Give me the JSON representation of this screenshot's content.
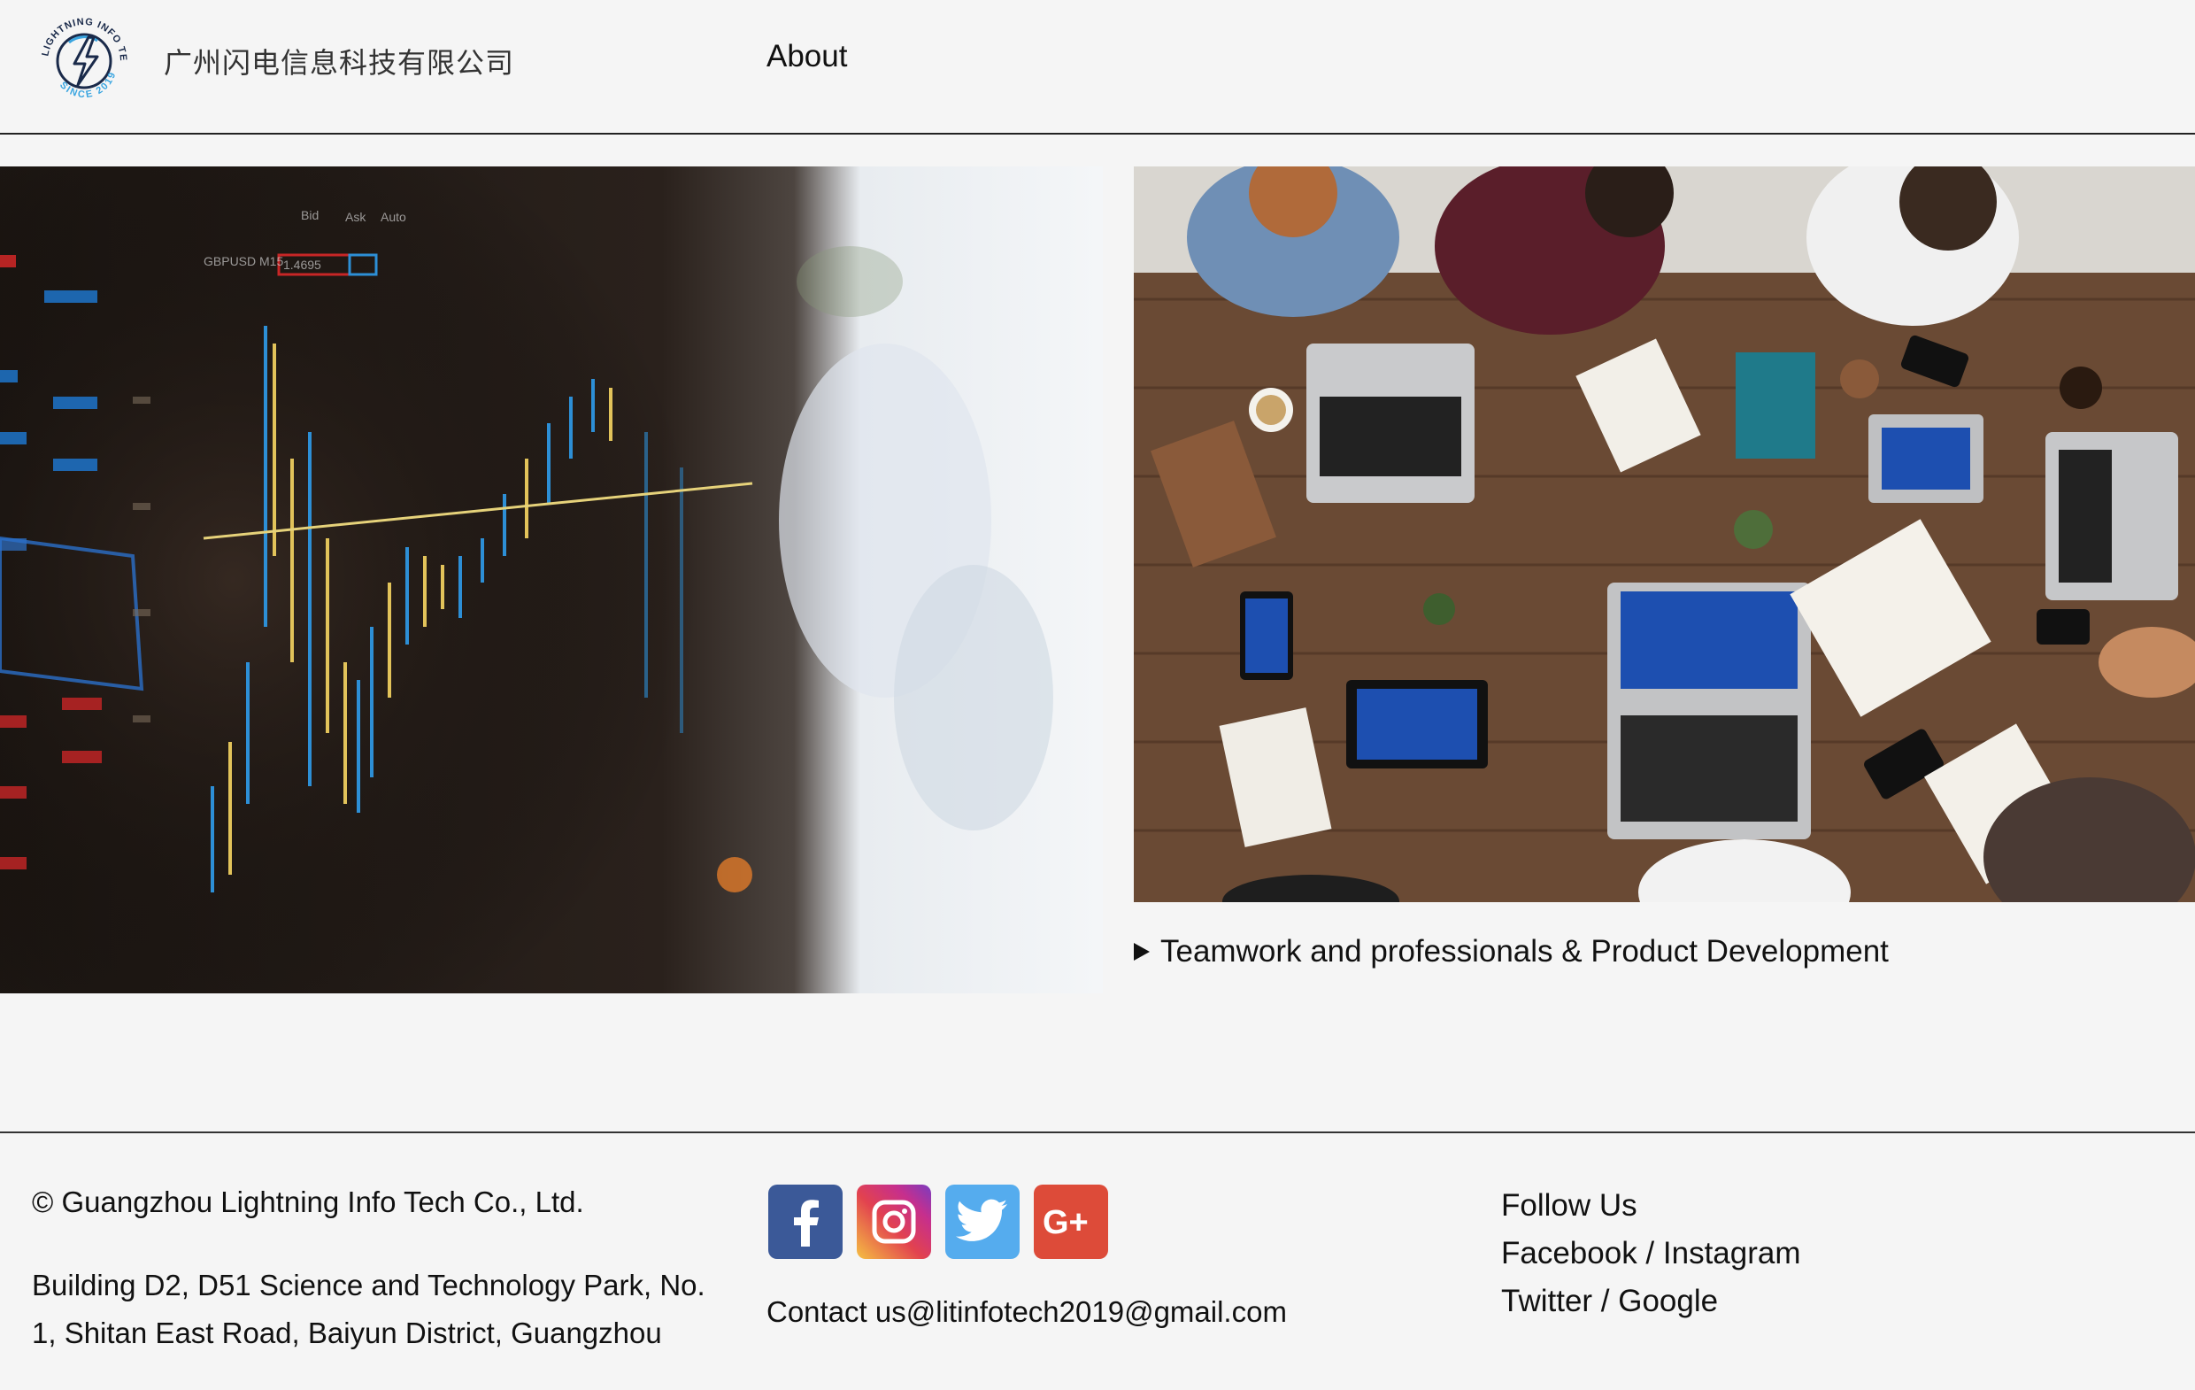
{
  "header": {
    "logo_text_top": "LIGHTNING INFO TECH",
    "logo_text_bottom": "SINCE 2019",
    "company_name_cn": "广州闪电信息科技有限公司",
    "nav_about": "About"
  },
  "gallery": {
    "left_image": "stock-chart-monitor-photo",
    "right_image": "team-meeting-table-photo",
    "caption": "Teamwork and professionals & Product Development"
  },
  "footer": {
    "copyright": "© Guangzhou Lightning Info Tech Co., Ltd.",
    "address": "Building D2, D51 Science and Technology Park, No. 1, Shitan East Road, Baiyun District, Guangzhou",
    "contact": "Contact us@litinfotech2019@gmail.com",
    "social_icons": [
      {
        "name": "facebook-icon",
        "color": "#3b5998"
      },
      {
        "name": "instagram-icon",
        "color": "#d6307a"
      },
      {
        "name": "twitter-icon",
        "color": "#55acee"
      },
      {
        "name": "google-plus-icon",
        "color": "#dd4b39"
      }
    ],
    "follow_title": "Follow Us",
    "follow_line1": "Facebook / Instagram",
    "follow_line2": "Twitter / Google"
  }
}
